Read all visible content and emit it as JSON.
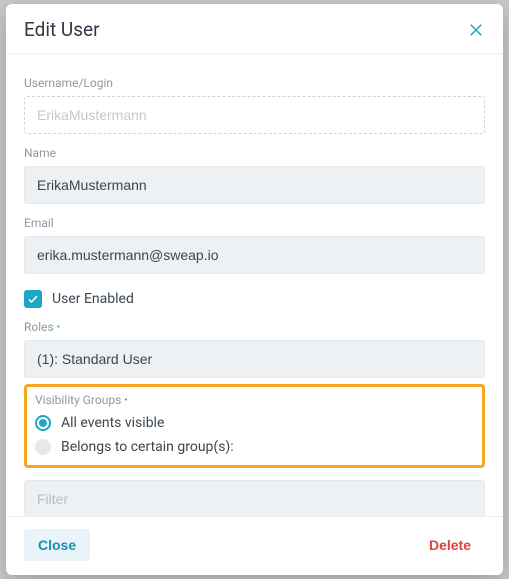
{
  "modal": {
    "title": "Edit User"
  },
  "fields": {
    "username_label": "Username/Login",
    "username_value": "ErikaMustermann",
    "name_label": "Name",
    "name_value": "ErikaMustermann",
    "email_label": "Email",
    "email_value": "erika.mustermann@sweap.io",
    "user_enabled_label": "User Enabled",
    "roles_label": "Roles",
    "roles_value": "(1): Standard User",
    "visibility_label": "Visibility Groups",
    "visibility_options": {
      "all": "All events visible",
      "groups": "Belongs to certain group(s):"
    },
    "filter_placeholder": "Filter"
  },
  "footer": {
    "close_label": "Close",
    "delete_label": "Delete"
  },
  "colors": {
    "accent": "#1ea7c4",
    "highlight": "#f5a623",
    "danger": "#d9463d"
  }
}
